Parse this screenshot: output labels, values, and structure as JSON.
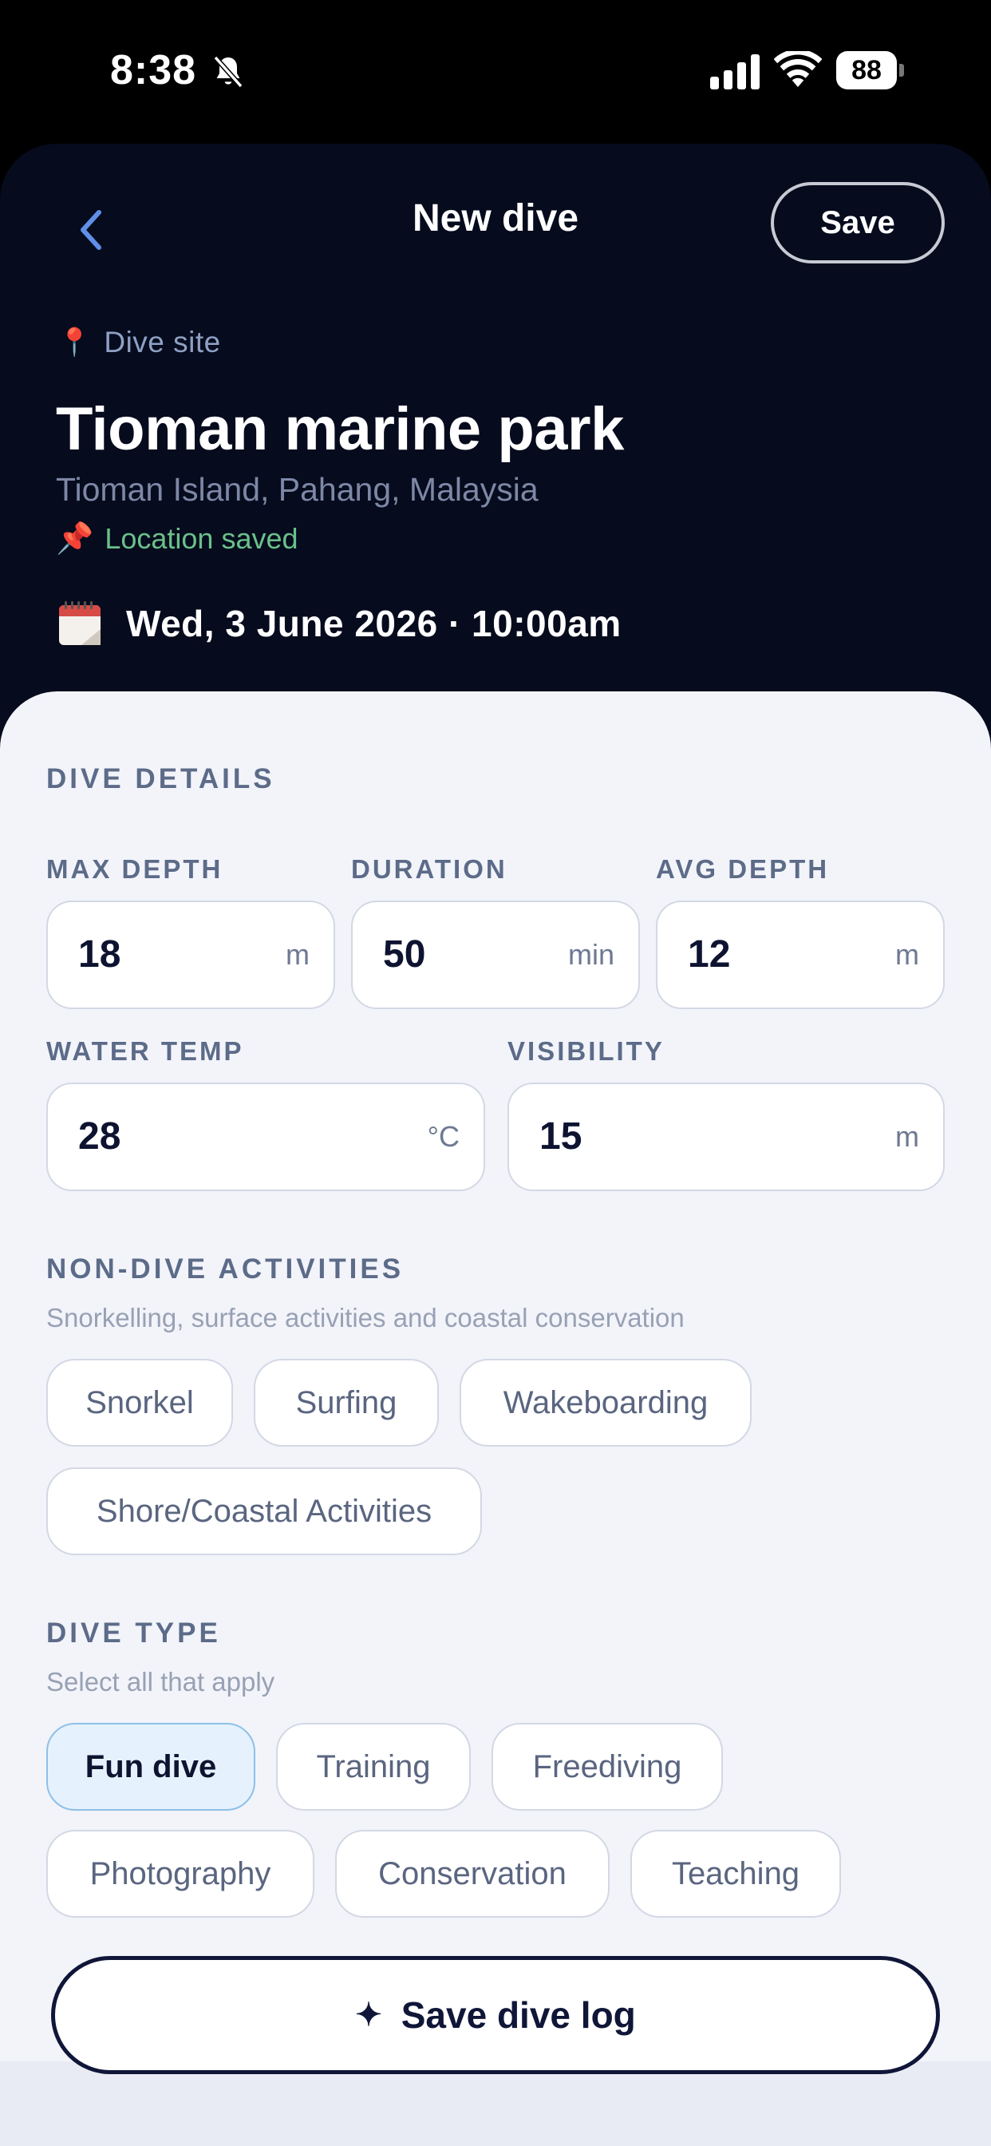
{
  "status_bar": {
    "time": "8:38",
    "battery": "88"
  },
  "header": {
    "title": "New dive",
    "save_label": "Save"
  },
  "site": {
    "label": "Dive site",
    "name": "Tioman marine park",
    "region": "Tioman Island, Pahang, Malaysia",
    "location_status": "Location saved"
  },
  "datetime": {
    "text": "Wed, 3 June 2026  ·  10:00am"
  },
  "dive_details": {
    "title": "DIVE DETAILS",
    "max_depth": {
      "label": "MAX DEPTH",
      "value": "18",
      "unit": "m"
    },
    "duration": {
      "label": "DURATION",
      "value": "50",
      "unit": "min"
    },
    "avg_depth": {
      "label": "AVG DEPTH",
      "value": "12",
      "unit": "m"
    },
    "water_temp": {
      "label": "WATER TEMP",
      "value": "28",
      "unit": "°C"
    },
    "visibility": {
      "label": "VISIBILITY",
      "value": "15",
      "unit": "m"
    }
  },
  "non_dive": {
    "title": "NON-DIVE ACTIVITIES",
    "subtitle": "Snorkelling, surface activities and coastal conservation",
    "chips": [
      "Snorkel",
      "Surfing",
      "Wakeboarding",
      "Shore/Coastal Activities"
    ]
  },
  "dive_type": {
    "title": "DIVE TYPE",
    "subtitle": "Select all that apply",
    "chips": [
      "Fun dive",
      "Training",
      "Freediving",
      "Photography",
      "Conservation",
      "Teaching"
    ],
    "selected": [
      "Fun dive"
    ]
  },
  "footer": {
    "save_label": "Save dive log"
  },
  "colors": {
    "header_bg": "#060b1d",
    "panel_bg": "#f2f4fa",
    "selected_chip_bg": "#e5f2fd",
    "location_green": "#6ac18a",
    "accent_navy": "#0f1638"
  }
}
